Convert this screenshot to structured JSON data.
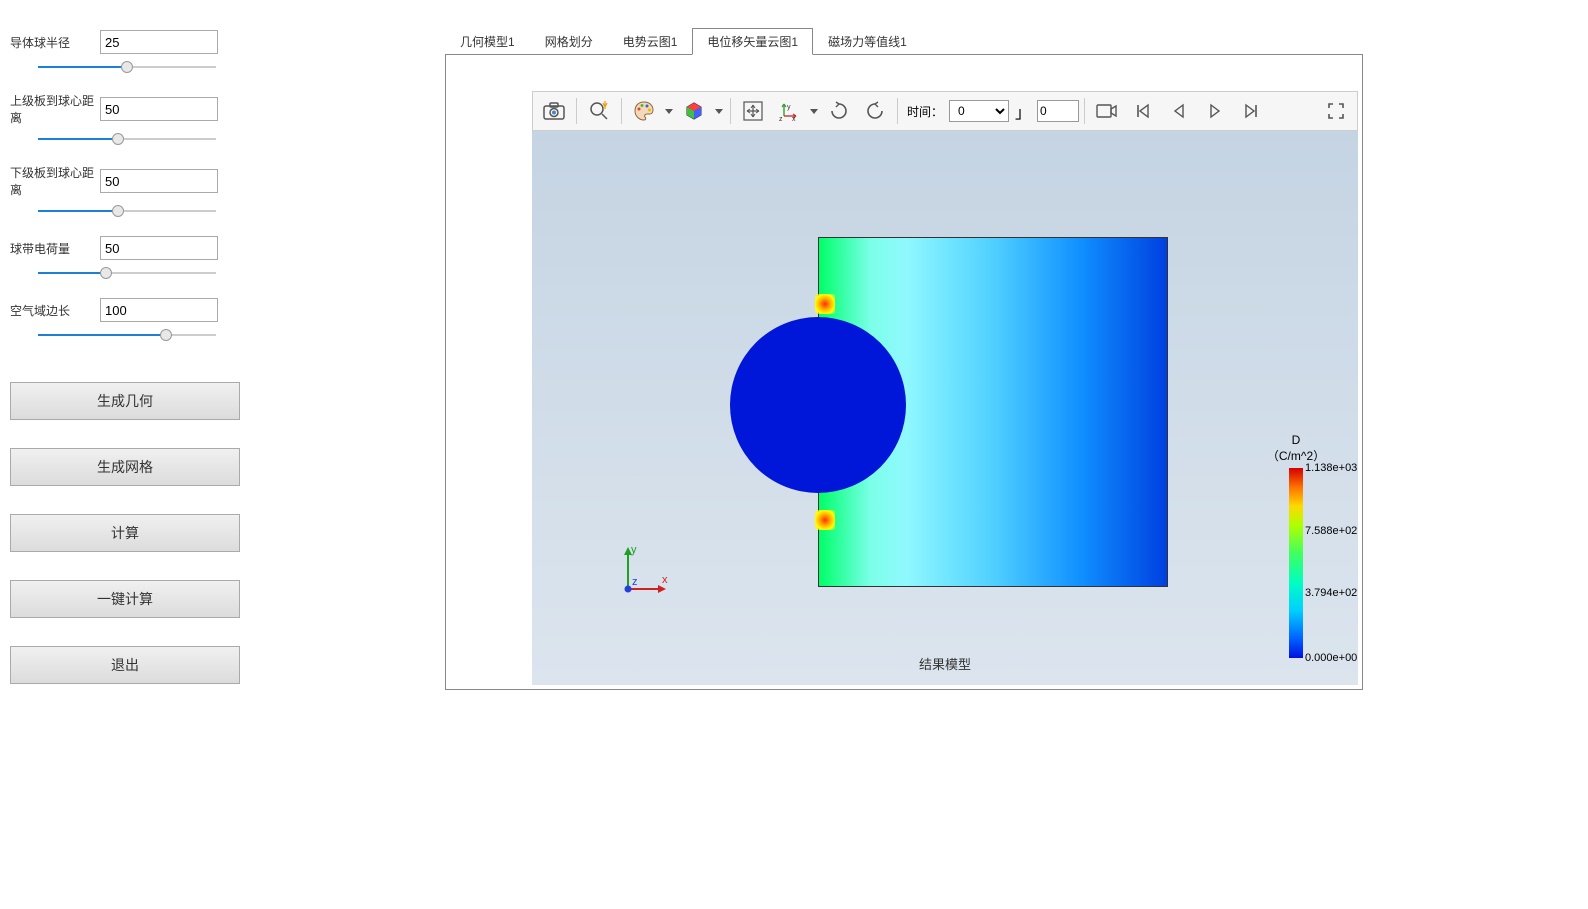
{
  "params": [
    {
      "label": "导体球半径",
      "value": "25",
      "fillPct": 50,
      "thumbPct": 50
    },
    {
      "label": "上级板到球心距离",
      "value": "50",
      "fillPct": 45,
      "thumbPct": 45
    },
    {
      "label": "下级板到球心距离",
      "value": "50",
      "fillPct": 45,
      "thumbPct": 45
    },
    {
      "label": "球带电荷量",
      "value": "50",
      "fillPct": 38,
      "thumbPct": 38
    },
    {
      "label": "空气域边长",
      "value": "100",
      "fillPct": 72,
      "thumbPct": 72
    }
  ],
  "buttons": {
    "gen_geom": "生成几何",
    "gen_mesh": "生成网格",
    "compute": "计算",
    "one_click": "一键计算",
    "exit": "退出"
  },
  "tabs": [
    {
      "label": "几何模型1",
      "active": false
    },
    {
      "label": "网格划分",
      "active": false
    },
    {
      "label": "电势云图1",
      "active": false
    },
    {
      "label": "电位移矢量云图1",
      "active": true
    },
    {
      "label": "磁场力等值线1",
      "active": false
    }
  ],
  "toolbar": {
    "time_label": "时间：",
    "time_select": "0",
    "frame_value": "0"
  },
  "legend": {
    "title1": "D",
    "title2": "（C/m^2）",
    "ticks": [
      {
        "label": "1.138e+03",
        "pos": 0
      },
      {
        "label": "7.588e+02",
        "pos": 33
      },
      {
        "label": "3.794e+02",
        "pos": 66
      },
      {
        "label": "0.000e+00",
        "pos": 100
      }
    ]
  },
  "axis": {
    "x": "x",
    "y": "y",
    "z": "z"
  },
  "result_label": "结果模型"
}
